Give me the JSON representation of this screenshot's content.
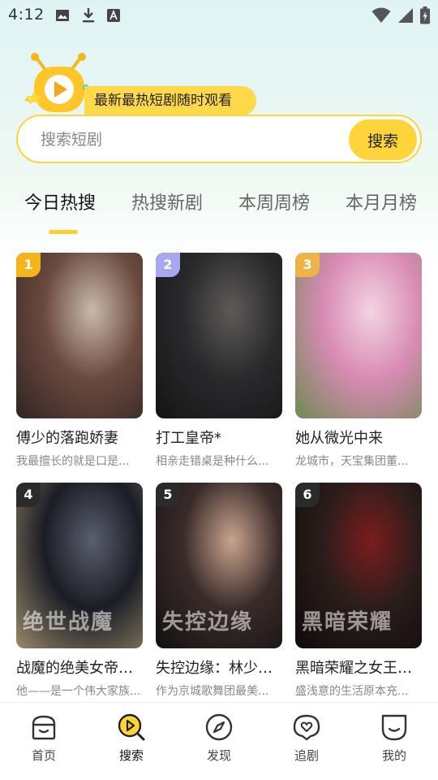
{
  "status": {
    "time": "4:12"
  },
  "header": {
    "slogan": "最新最热短剧随时观看"
  },
  "search": {
    "placeholder": "搜索短剧",
    "button": "搜索"
  },
  "tabs": [
    {
      "label": "今日热搜",
      "active": true
    },
    {
      "label": "热搜新剧",
      "active": false
    },
    {
      "label": "本周周榜",
      "active": false
    },
    {
      "label": "本月月榜",
      "active": false
    }
  ],
  "dramas": [
    {
      "rank": "1",
      "title": "傅少的落跑娇妻",
      "desc": "我最擅长的就是口是...",
      "poster_text": "",
      "colors": [
        "#6b4a3f",
        "#c9b9ad",
        "#2f2422"
      ],
      "badge": "#f4b41a"
    },
    {
      "rank": "2",
      "title": "打工皇帝*",
      "desc": "相亲走错桌是种什么...",
      "poster_text": "",
      "colors": [
        "#2a2a2c",
        "#5e5a58",
        "#141415"
      ],
      "badge": "#a9a7f2"
    },
    {
      "rank": "3",
      "title": "她从微光中来",
      "desc": "龙城市，天宝集团董...",
      "poster_text": "",
      "colors": [
        "#d88bb4",
        "#f3d4e2",
        "#6e8a53"
      ],
      "badge": "#f0b34a"
    },
    {
      "rank": "4",
      "title": "战魔的绝美女帝老...",
      "desc": "他——是一个伟大家族...",
      "poster_text": "绝世战魔",
      "colors": [
        "#1b1d25",
        "#5a5e6e",
        "#9a8a6a"
      ],
      "badge": "#2b2b2b"
    },
    {
      "rank": "5",
      "title": "失控边缘：林少的...",
      "desc": "作为京城歌舞团最美...",
      "poster_text": "失控边缘",
      "colors": [
        "#3a2b2a",
        "#c9a48e",
        "#121010"
      ],
      "badge": "#2b2b2b"
    },
    {
      "rank": "6",
      "title": "黑暗荣耀之女王归...",
      "desc": "盛浅意的生活原本充...",
      "poster_text": "黑暗荣耀",
      "colors": [
        "#2b1d1b",
        "#7a1d1d",
        "#0e0b0a"
      ],
      "badge": "#2b2b2b"
    }
  ],
  "nav": [
    {
      "label": "首页",
      "icon": "home-icon",
      "active": false
    },
    {
      "label": "搜索",
      "icon": "search-play-icon",
      "active": true
    },
    {
      "label": "发现",
      "icon": "compass-icon",
      "active": false
    },
    {
      "label": "追剧",
      "icon": "heart-chat-icon",
      "active": false
    },
    {
      "label": "我的",
      "icon": "profile-smile-icon",
      "active": false
    }
  ]
}
